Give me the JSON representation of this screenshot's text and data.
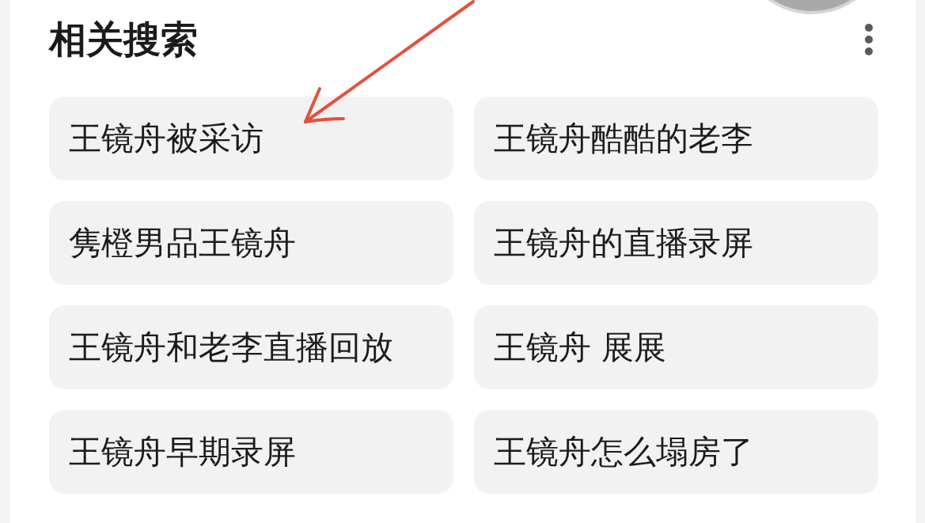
{
  "section": {
    "title": "相关搜索"
  },
  "related_searches": [
    {
      "label": "王镜舟被采访"
    },
    {
      "label": "王镜舟酷酷的老李"
    },
    {
      "label": "隽橙男品王镜舟"
    },
    {
      "label": "王镜舟的直播录屏"
    },
    {
      "label": "王镜舟和老李直播回放"
    },
    {
      "label": "王镜舟 展展"
    },
    {
      "label": "王镜舟早期录屏"
    },
    {
      "label": "王镜舟怎么塌房了"
    }
  ]
}
